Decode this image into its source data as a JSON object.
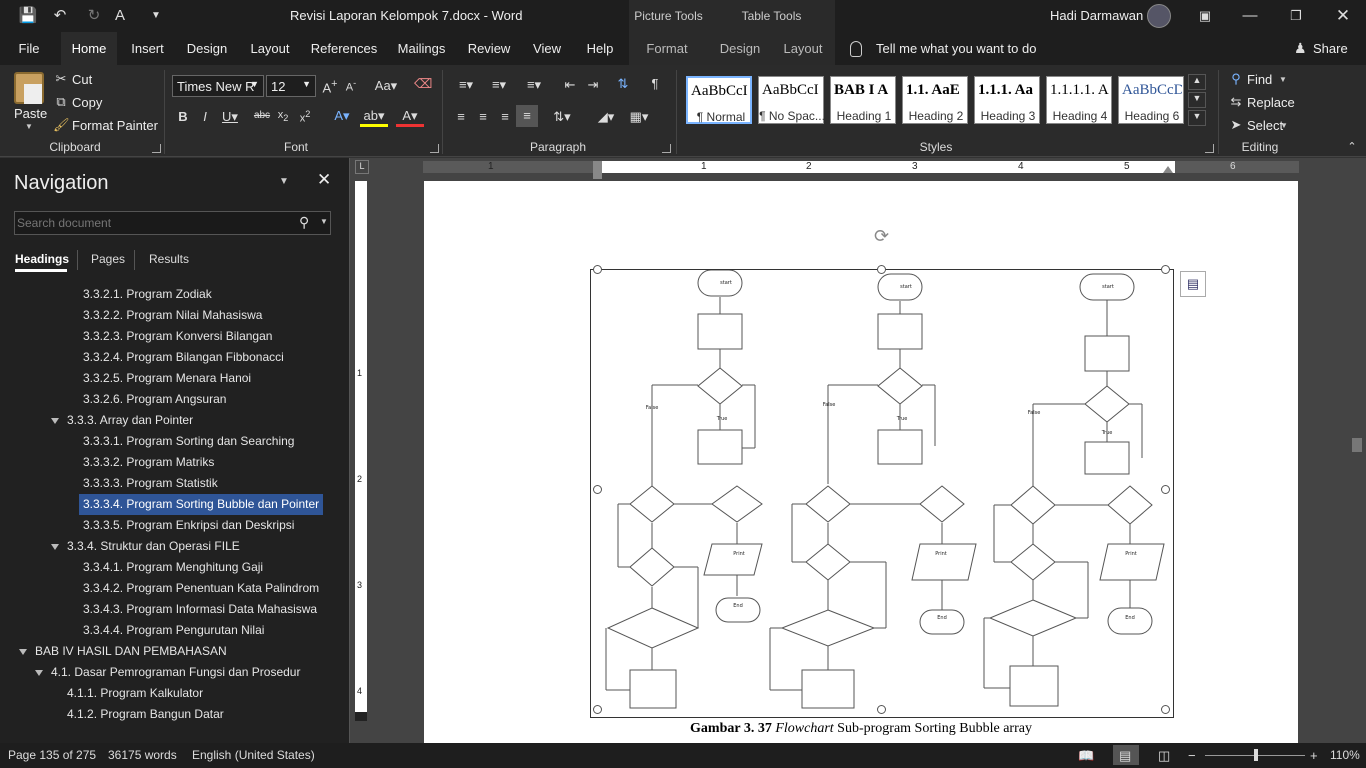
{
  "window": {
    "doc_title": "Revisi Laporan Kelompok 7.docx",
    "app": "Word",
    "user": "Hadi Darmawan",
    "picture_tools": "Picture Tools",
    "table_tools": "Table Tools"
  },
  "tabs": [
    "File",
    "Home",
    "Insert",
    "Design",
    "Layout",
    "References",
    "Mailings",
    "Review",
    "View",
    "Help",
    "Format",
    "Design",
    "Layout"
  ],
  "tell_me": "Tell me what you want to do",
  "share": "Share",
  "clipboard": {
    "paste": "Paste",
    "cut": "Cut",
    "copy": "Copy",
    "format_painter": "Format Painter",
    "label": "Clipboard"
  },
  "font": {
    "name": "Times New R",
    "size": "12",
    "label": "Font"
  },
  "paragraph": {
    "label": "Paragraph"
  },
  "styles": {
    "label": "Styles",
    "items": [
      {
        "preview": "AaBbCcI",
        "name": "¶ Normal"
      },
      {
        "preview": "AaBbCcI",
        "name": "¶ No Spac..."
      },
      {
        "preview": "BAB I A",
        "name": "Heading 1"
      },
      {
        "preview": "1.1. AaE",
        "name": "Heading 2"
      },
      {
        "preview": "1.1.1. Aa",
        "name": "Heading 3"
      },
      {
        "preview": "1.1.1.1. A",
        "name": "Heading 4"
      },
      {
        "preview": "AaBbCcD",
        "name": "Heading 6"
      }
    ]
  },
  "editing": {
    "find": "Find",
    "replace": "Replace",
    "select": "Select",
    "label": "Editing"
  },
  "nav": {
    "title": "Navigation",
    "search_placeholder": "Search document",
    "tabs": [
      "Headings",
      "Pages",
      "Results"
    ],
    "items": [
      "3.3.2.1. Program Zodiak",
      "3.3.2.2. Program Nilai Mahasiswa",
      "3.3.2.3. Program Konversi Bilangan",
      "3.3.2.4. Program Bilangan Fibbonacci",
      "3.3.2.5. Program Menara Hanoi",
      "3.3.2.6. Program Angsuran",
      "3.3.3. Array dan Pointer",
      "3.3.3.1. Program Sorting dan Searching",
      "3.3.3.2. Program Matriks",
      "3.3.3.3. Program Statistik",
      "3.3.3.4. Program Sorting Bubble dan Pointer",
      "3.3.3.5. Program Enkripsi dan Deskripsi",
      "3.3.4. Struktur dan Operasi FILE",
      "3.3.4.1. Program Menghitung Gaji",
      "3.3.4.2. Program Penentuan Kata Palindrom",
      "3.3.4.3. Program Informasi Data Mahasiswa",
      "3.3.4.4. Program Pengurutan Nilai",
      "BAB IV  HASIL DAN PEMBAHASAN",
      "4.1. Dasar Pemrograman Fungsi dan Prosedur",
      "4.1.1. Program Kalkulator",
      "4.1.2. Program Bangun Datar"
    ]
  },
  "ruler": [
    "1",
    "2",
    "3",
    "4",
    "5",
    "6"
  ],
  "vruler": [
    "1",
    "2",
    "3",
    "4"
  ],
  "flow": {
    "start": "start",
    "init": "X=0\nA=0\nB=0",
    "end1": "End",
    "end2": "End",
    "end3": "End",
    "true": "True",
    "false": "False",
    "print": "Print"
  },
  "caption": {
    "bold": "Gambar 3. 37",
    "italic": "Flowchart",
    "rest": " Sub-program Sorting Bubble array"
  },
  "status": {
    "page": "Page 135 of 275",
    "words": "36175 words",
    "lang": "English (United States)",
    "zoom": "110%"
  }
}
